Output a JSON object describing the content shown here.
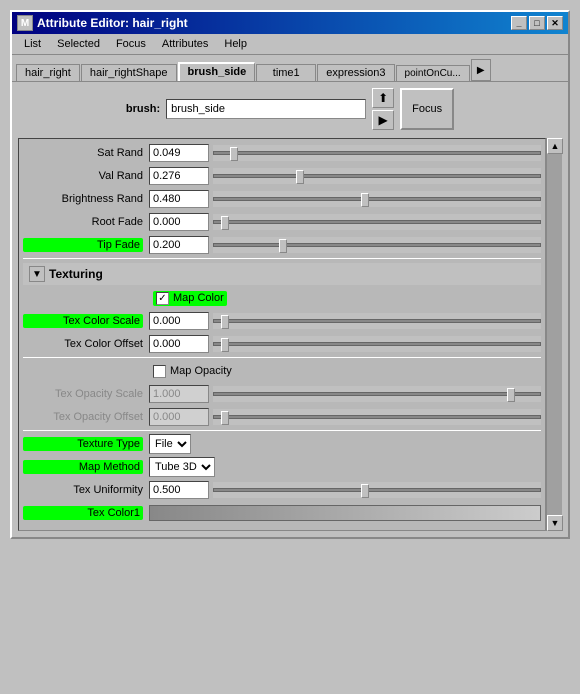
{
  "window": {
    "title": "Attribute Editor: hair_right",
    "title_icon": "M"
  },
  "menu": {
    "items": [
      "List",
      "Selected",
      "Focus",
      "Attributes",
      "Help"
    ]
  },
  "tabs": {
    "items": [
      "hair_right",
      "hair_rightShape",
      "brush_side",
      "time1",
      "expression3",
      "pointOnCu..."
    ],
    "active": "brush_side"
  },
  "brush": {
    "label": "brush:",
    "value": "brush_side",
    "focus_label": "Focus"
  },
  "params": {
    "sat_rand": {
      "label": "Sat Rand",
      "value": "0.049",
      "slider_pos": "5",
      "highlighted": false
    },
    "val_rand": {
      "label": "Val Rand",
      "value": "0.276",
      "slider_pos": "25",
      "highlighted": false
    },
    "brightness_rand": {
      "label": "Brightness Rand",
      "value": "0.480",
      "slider_pos": "45",
      "highlighted": false
    },
    "root_fade": {
      "label": "Root Fade",
      "value": "0.000",
      "slider_pos": "2",
      "highlighted": false
    },
    "tip_fade": {
      "label": "Tip Fade",
      "value": "0.200",
      "slider_pos": "20",
      "highlighted": true
    }
  },
  "texturing": {
    "section_label": "Texturing",
    "map_color": {
      "label": "Map Color",
      "checked": true,
      "highlighted": true
    },
    "tex_color_scale": {
      "label": "Tex Color Scale",
      "value": "0.000",
      "slider_pos": "2",
      "highlighted": true
    },
    "tex_color_offset": {
      "label": "Tex Color Offset",
      "value": "0.000",
      "slider_pos": "2",
      "highlighted": false
    },
    "map_opacity": {
      "label": "Map Opacity",
      "checked": false,
      "highlighted": false
    },
    "tex_opacity_scale": {
      "label": "Tex Opacity Scale",
      "value": "1.000",
      "slider_pos": "95",
      "highlighted": false,
      "dimmed": true
    },
    "tex_opacity_offset": {
      "label": "Tex Opacity Offset",
      "value": "0.000",
      "slider_pos": "2",
      "highlighted": false,
      "dimmed": true
    },
    "texture_type": {
      "label": "Texture Type",
      "value": "File",
      "highlighted": true
    },
    "map_method": {
      "label": "Map Method",
      "value": "Tube 3D",
      "highlighted": true
    },
    "tex_uniformity": {
      "label": "Tex Uniformity",
      "value": "0.500",
      "slider_pos": "45",
      "highlighted": false
    },
    "tex_color1": {
      "label": "Tex Color1",
      "highlighted": true
    }
  },
  "icons": {
    "upload": "⬆",
    "arrow_right": "▶",
    "scroll_up": "▲",
    "scroll_down": "▼",
    "tab_arrow": "▶",
    "collapse": "▼",
    "checkmark": "✓"
  }
}
